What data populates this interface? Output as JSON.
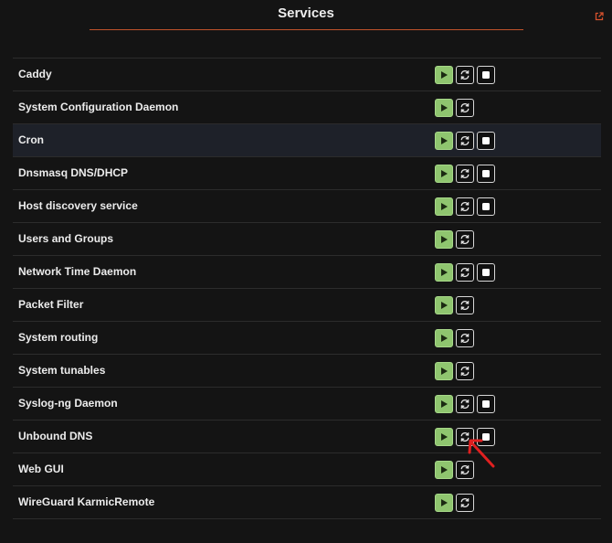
{
  "header": {
    "title": "Services",
    "external_link_icon": "external-link-icon",
    "accent_color": "#c0532b"
  },
  "buttons": {
    "start_icon": "play-icon",
    "restart_icon": "refresh-icon",
    "stop_icon": "stop-icon",
    "start_color": "#8fc56f"
  },
  "services": [
    {
      "name": "Caddy",
      "running": true
    },
    {
      "name": "System Configuration Daemon",
      "running": false
    },
    {
      "name": "Cron",
      "running": true,
      "highlighted": true
    },
    {
      "name": "Dnsmasq DNS/DHCP",
      "running": true
    },
    {
      "name": "Host discovery service",
      "running": true
    },
    {
      "name": "Users and Groups",
      "running": false
    },
    {
      "name": "Network Time Daemon",
      "running": true
    },
    {
      "name": "Packet Filter",
      "running": false
    },
    {
      "name": "System routing",
      "running": false
    },
    {
      "name": "System tunables",
      "running": false
    },
    {
      "name": "Syslog-ng Daemon",
      "running": true
    },
    {
      "name": "Unbound DNS",
      "running": true
    },
    {
      "name": "Web GUI",
      "running": false
    },
    {
      "name": "WireGuard KarmicRemote",
      "running": false
    }
  ],
  "annotation": {
    "type": "red-arrow",
    "color": "#e02020",
    "target": "Unbound DNS restart button"
  }
}
